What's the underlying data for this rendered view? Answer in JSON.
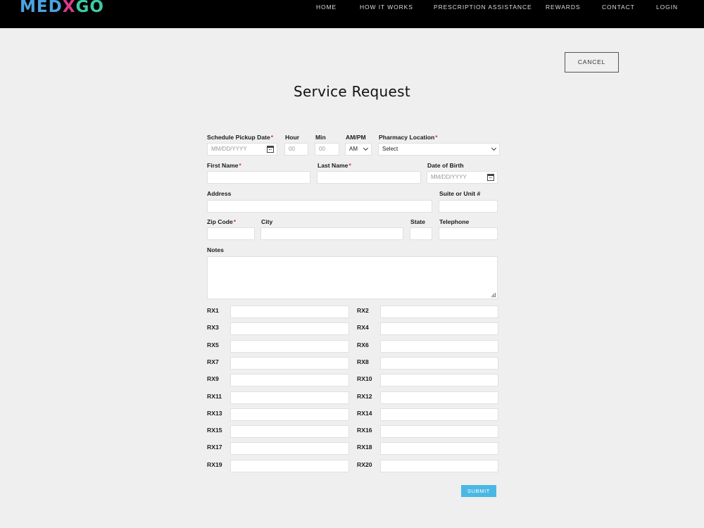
{
  "header": {
    "logo": {
      "part1": "MED",
      "part2": "X",
      "part3": "GO"
    },
    "nav": [
      "HOME",
      "HOW IT WORKS",
      "PRESCRIPTION ASSISTANCE",
      "REWARDS",
      "CONTACT",
      "LOGIN"
    ]
  },
  "page": {
    "cancel_label": "CANCEL",
    "title": "Service Request"
  },
  "form": {
    "pickup_date": {
      "label": "Schedule Pickup Date",
      "placeholder": "MM/DD/YYYY"
    },
    "hour": {
      "label": "Hour",
      "placeholder": "00"
    },
    "min": {
      "label": "Min",
      "placeholder": "00"
    },
    "ampm": {
      "label": "AM/PM",
      "value": "AM"
    },
    "pharmacy": {
      "label": "Pharmacy Location",
      "value": "Select"
    },
    "first_name": {
      "label": "First Name"
    },
    "last_name": {
      "label": "Last Name"
    },
    "dob": {
      "label": "Date of Birth",
      "placeholder": "MM/DD/YYYY"
    },
    "address": {
      "label": "Address"
    },
    "suite": {
      "label": "Suite or Unit #"
    },
    "zip": {
      "label": "Zip Code"
    },
    "city": {
      "label": "City"
    },
    "state": {
      "label": "State"
    },
    "telephone": {
      "label": "Telephone"
    },
    "notes": {
      "label": "Notes"
    },
    "required_mark": "*",
    "rx": [
      "RX1",
      "RX2",
      "RX3",
      "RX4",
      "RX5",
      "RX6",
      "RX7",
      "RX8",
      "RX9",
      "RX10",
      "RX11",
      "RX12",
      "RX13",
      "RX14",
      "RX15",
      "RX16",
      "RX17",
      "RX18",
      "RX19",
      "RX20"
    ],
    "submit_label": "SUBMIT"
  }
}
